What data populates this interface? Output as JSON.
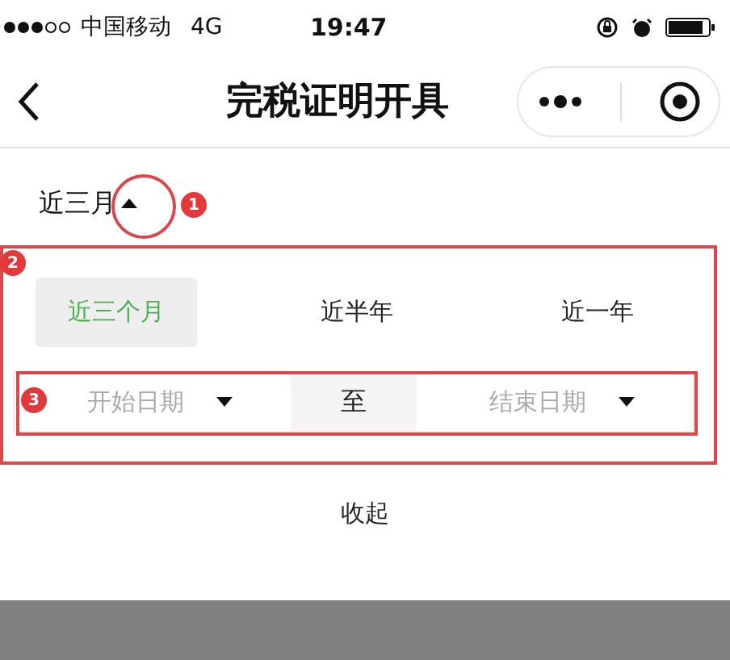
{
  "status_bar": {
    "carrier": "中国移动",
    "network": "4G",
    "time": "19:47"
  },
  "nav": {
    "title": "完税证明开具"
  },
  "filter": {
    "label": "近三月",
    "expanded": true
  },
  "periods": [
    {
      "label": "近三个月",
      "selected": true
    },
    {
      "label": "近半年",
      "selected": false
    },
    {
      "label": "近一年",
      "selected": false
    }
  ],
  "date_range": {
    "start": {
      "placeholder": "开始日期"
    },
    "separator": "至",
    "end": {
      "placeholder": "结束日期"
    }
  },
  "collapse_button": "收起",
  "annotations": [
    {
      "label": "1"
    },
    {
      "label": "2"
    },
    {
      "label": "3"
    }
  ]
}
